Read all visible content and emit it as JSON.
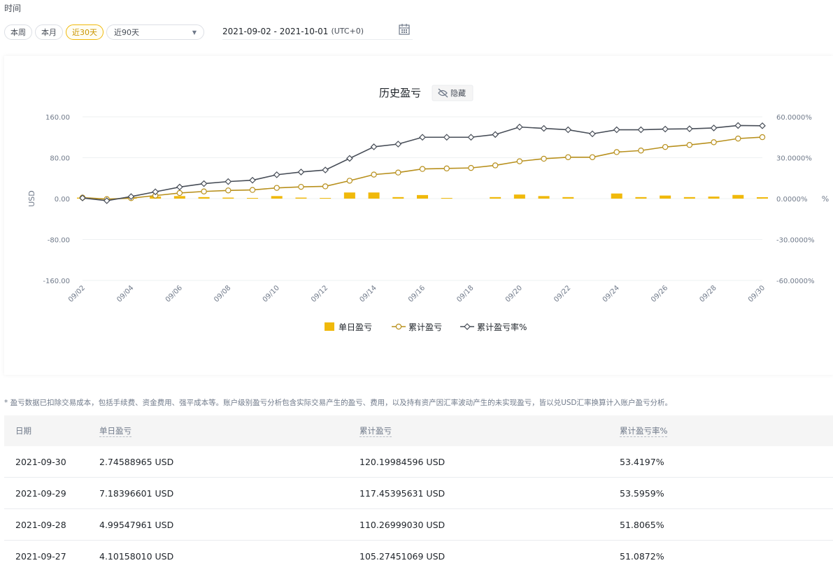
{
  "section_label": "时间",
  "filters": {
    "pills": [
      {
        "label": "本周",
        "active": false
      },
      {
        "label": "本月",
        "active": false
      },
      {
        "label": "近30天",
        "active": true
      }
    ],
    "select_value": "近90天",
    "date_range": "2021-09-02 - 2021-10-01",
    "timezone": "(UTC+0)"
  },
  "chart": {
    "title": "历史盈亏",
    "hide_label": "隐藏",
    "legend": {
      "daily": "单日盈亏",
      "cumulative": "累计盈亏",
      "rate": "累计盈亏率%"
    }
  },
  "colors": {
    "accent": "#f0b90b",
    "cumulative": "#b8901d",
    "rate": "#474d57"
  },
  "chart_data": {
    "type": "line",
    "title": "历史盈亏",
    "ylabel": "USD",
    "y2label": "%",
    "ylim": [
      -160,
      160
    ],
    "y2lim": [
      -60,
      60
    ],
    "yticks": [
      "160.00",
      "80.00",
      "0.00",
      "-80.00",
      "-160.00"
    ],
    "y2ticks": [
      "60.0000%",
      "30.0000%",
      "0.0000%",
      "-30.0000%",
      "-60.0000%"
    ],
    "xticks": [
      "09/02",
      "09/04",
      "09/06",
      "09/08",
      "09/10",
      "09/12",
      "09/14",
      "09/16",
      "09/18",
      "09/20",
      "09/22",
      "09/24",
      "09/26",
      "09/28",
      "09/30"
    ],
    "x": [
      "09/02",
      "09/03",
      "09/04",
      "09/05",
      "09/06",
      "09/07",
      "09/08",
      "09/09",
      "09/10",
      "09/11",
      "09/12",
      "09/13",
      "09/14",
      "09/15",
      "09/16",
      "09/17",
      "09/18",
      "09/19",
      "09/20",
      "09/21",
      "09/22",
      "09/23",
      "09/24",
      "09/25",
      "09/26",
      "09/27",
      "09/28",
      "09/29",
      "09/30"
    ],
    "legend_position": "bottom",
    "series": [
      {
        "name": "单日盈亏",
        "type": "bar",
        "axis": "left",
        "values": [
          2,
          -1,
          2,
          4,
          5,
          3,
          2,
          1,
          5,
          2,
          1,
          12,
          12,
          3,
          7,
          1,
          0,
          3,
          8,
          5,
          3,
          0,
          10,
          3,
          6,
          3,
          4,
          7.18,
          2.75
        ]
      },
      {
        "name": "累计盈亏",
        "type": "line",
        "axis": "left",
        "values": [
          2,
          -1,
          1,
          6,
          11,
          14,
          16,
          17,
          21,
          23,
          24,
          35,
          47,
          51,
          58,
          59,
          60,
          65,
          73,
          78,
          81,
          81,
          91,
          94,
          101,
          105,
          110.27,
          117.45,
          120.2
        ]
      },
      {
        "name": "累计盈亏率%",
        "type": "line",
        "axis": "right",
        "values": [
          0.5,
          -1.5,
          1.5,
          5,
          8.5,
          11,
          12.5,
          13.5,
          17.5,
          19.5,
          21,
          29.5,
          38,
          40,
          45,
          45,
          45,
          47,
          52.5,
          51.5,
          50.5,
          47.5,
          50.5,
          50.5,
          51,
          51.2,
          51.81,
          53.6,
          53.42
        ]
      }
    ]
  },
  "footnote": "* 盈亏数据已扣除交易成本，包括手续费、资金费用、强平成本等。账户级别盈亏分析包含实际交易产生的盈亏、费用，以及持有资产因汇率波动产生的未实现盈亏，皆以兑USD汇率换算计入账户盈亏分析。",
  "table": {
    "headers": [
      "日期",
      "单日盈亏",
      "累计盈亏",
      "累计盈亏率%"
    ],
    "rows": [
      [
        "2021-09-30",
        "2.74588965 USD",
        "120.19984596 USD",
        "53.4197%"
      ],
      [
        "2021-09-29",
        "7.18396601 USD",
        "117.45395631 USD",
        "53.5959%"
      ],
      [
        "2021-09-28",
        "4.99547961 USD",
        "110.26999030 USD",
        "51.8065%"
      ],
      [
        "2021-09-27",
        "4.10158010 USD",
        "105.27451069 USD",
        "51.0872%"
      ]
    ]
  }
}
